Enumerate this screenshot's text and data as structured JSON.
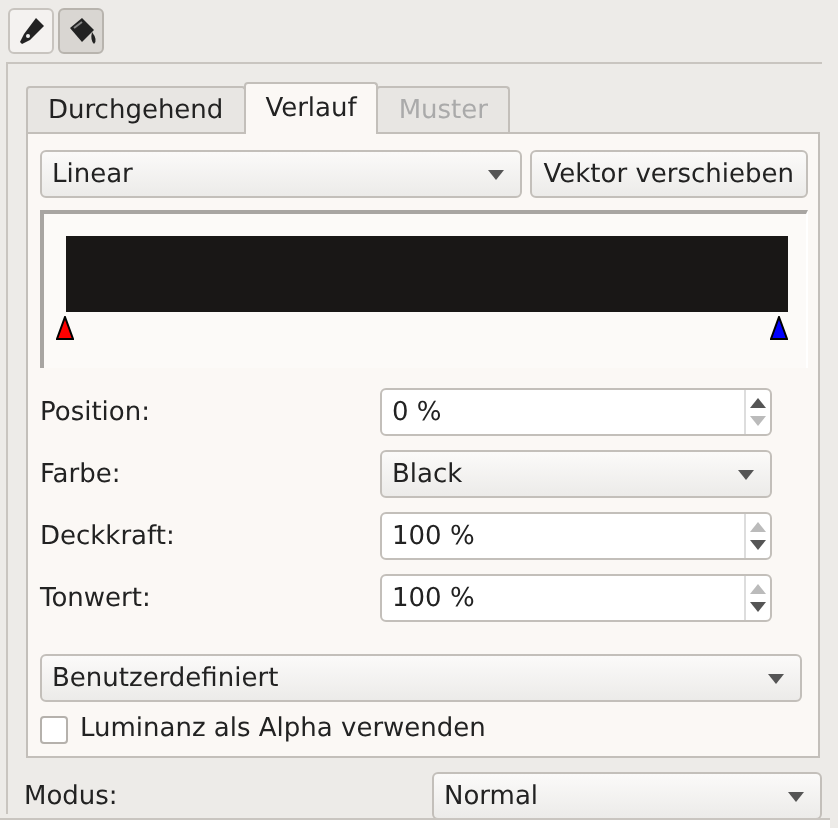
{
  "toolbar": [
    {
      "kind": "pen",
      "selected": false
    },
    {
      "kind": "bucket",
      "selected": true
    }
  ],
  "tabs": [
    {
      "label": "Durchgehend",
      "selected": false,
      "disabled": false
    },
    {
      "label": "Verlauf",
      "selected": true,
      "disabled": false
    },
    {
      "label": "Muster",
      "selected": false,
      "disabled": true
    }
  ],
  "gradient": {
    "type": "Linear",
    "button": "Vektor verschieben",
    "stops": [
      {
        "color": "#ff0000"
      },
      {
        "color": "#0000ff"
      }
    ]
  },
  "fields": [
    {
      "kind": "spin",
      "label": "Position:",
      "value": "0 %",
      "up_enabled": true,
      "down_enabled": false
    },
    {
      "kind": "dropdown",
      "label": "Farbe:",
      "value": "Black"
    },
    {
      "kind": "spin",
      "label": "Deckkraft:",
      "value": "100 %",
      "up_enabled": false,
      "down_enabled": true
    },
    {
      "kind": "spin",
      "label": "Tonwert:",
      "value": "100 %",
      "up_enabled": false,
      "down_enabled": true
    }
  ],
  "preset": "Benutzerdefiniert",
  "checkbox": {
    "label": "Luminanz als Alpha verwenden",
    "checked": false
  },
  "mode": {
    "label": "Modus:",
    "value": "Normal"
  }
}
